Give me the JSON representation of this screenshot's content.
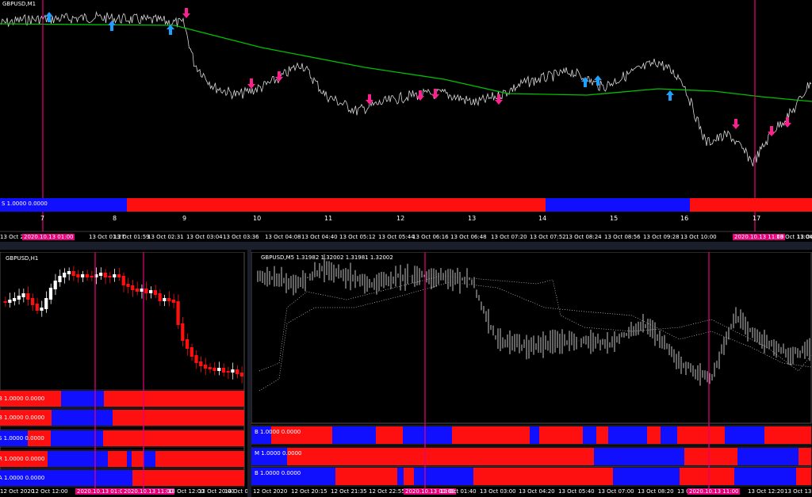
{
  "colors": {
    "buy": "#1010ff",
    "sell": "#ff1010",
    "ma": "#00c000",
    "marker": "#e6007a",
    "arrow_up": "#1ea0ff",
    "arrow_down": "#ff2090",
    "price": "#d8d8d8"
  },
  "top": {
    "title": "GBPUSD,M1",
    "strip_label": "S 1.0000 0.0000",
    "bar_numbers": [
      "7",
      "8",
      "9",
      "10",
      "11",
      "12",
      "13",
      "14",
      "15",
      "16",
      "17"
    ],
    "time_labels": [
      "13 Oct 2020",
      "2020.10.13 01:00",
      "13 Oct 01:27",
      "13 Oct 01:59",
      "13 Oct 02:31",
      "13 Oct 03:04",
      "13 Oct 03:36",
      "13 Oct 04:08",
      "13 Oct 04:40",
      "13 Oct 05:12",
      "13 Oct 05:44",
      "13 Oct 06:16",
      "13 Oct 06:48",
      "13 Oct 07:20",
      "13 Oct 07:52",
      "13 Oct 08:24",
      "13 Oct 08:56",
      "13 Oct 09:28",
      "13 Oct 10:00",
      "2020.10.13 11:00",
      "13 Oct 11:04",
      "13 Oc"
    ]
  },
  "left": {
    "title": "GBPUSD,H1",
    "strips": [
      "B 1.0000 0.0000",
      "B 1.0000 0.0000",
      "S 1.0000 0.0000",
      "R 1.0000 0.0000",
      "A 1.0000 0.0000"
    ],
    "time_labels": [
      "12 Oct 2020",
      "12 Oct 12:00",
      "2020.10.13 01:00",
      "2020.10.13 11:00",
      "13 Oct 12:00",
      "13 Oct 20:00",
      "14 Oct 0"
    ]
  },
  "right": {
    "title": "GBPUSD,M5  1.31982 1.32002 1.31981 1.32002",
    "strips": [
      "B 1.0000 0.0000",
      "M 1.0000 0.0000",
      "B 1.0000 0.0000"
    ],
    "time_labels": [
      "12 Oct 2020",
      "12 Oct 20:15",
      "12 Oct 21:35",
      "12 Oct 22:55",
      "2020.10.13 01:00",
      "13 Oct 01:40",
      "13 Oct 03:00",
      "13 Oct 04:20",
      "13 Oct 05:40",
      "13 Oct 07:00",
      "13 Oct 08:20",
      "13 Oct 09:40",
      "2020.10.13 11:00",
      "13 Oct 12:20",
      "13 Oct 13:"
    ]
  }
}
